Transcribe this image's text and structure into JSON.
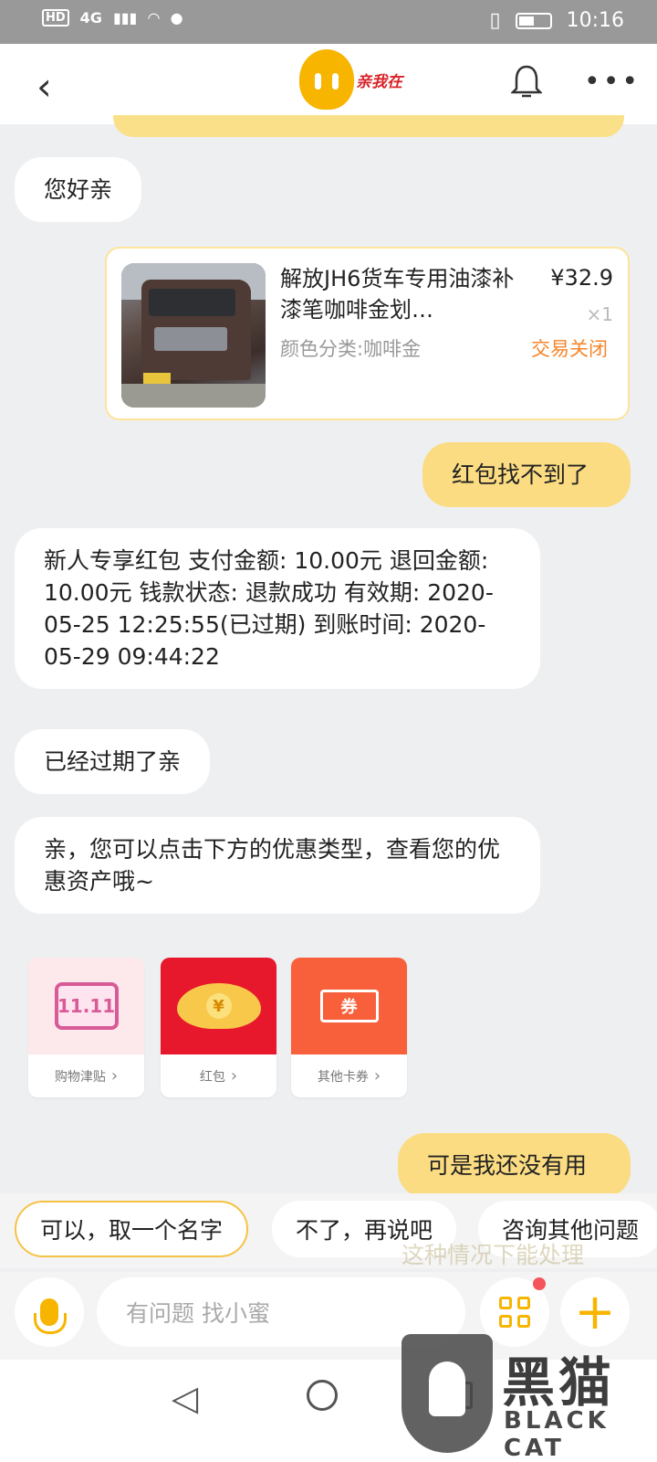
{
  "status_bar": {
    "left_labels": [
      "HD",
      "4G"
    ],
    "time": "10:16"
  },
  "header": {
    "logo_text": "亲我在"
  },
  "messages": {
    "greeting": "您好亲",
    "user_1": "红包找不到了",
    "redpacket_info": "新人专享红包 支付金额: 10.00元 退回金额: 10.00元 钱款状态: 退款成功 有效期: 2020-05-25 12:25:55(已过期) 到账时间: 2020-05-29 09:44:22",
    "expired": "已经过期了亲",
    "hint": "亲，您可以点击下方的优惠类型，查看您的优惠资产哦~",
    "user_2": "可是我还没有用"
  },
  "product": {
    "title": "解放JH6货车专用油漆补漆笔咖啡金划…",
    "variant": "颜色分类:咖啡金",
    "price": "¥32.9",
    "qty": "×1",
    "status": "交易关闭"
  },
  "coupons": [
    {
      "label": "购物津贴",
      "badge": "11.11"
    },
    {
      "label": "红包",
      "badge": "¥"
    },
    {
      "label": "其他卡券",
      "badge": "券"
    }
  ],
  "quick_replies": [
    "可以，取一个名字",
    "不了，再说吧",
    "咨询其他问题"
  ],
  "ghost_text": "这种情况下能处理",
  "input": {
    "placeholder": "有问题 找小蜜"
  },
  "watermark": {
    "main": "黑猫",
    "sub": "BLACK CAT"
  },
  "colors": {
    "accent": "#f7b500",
    "user_bubble": "#fbdc82",
    "status_closed": "#f5862c",
    "notification_dot": "#f4555a"
  }
}
